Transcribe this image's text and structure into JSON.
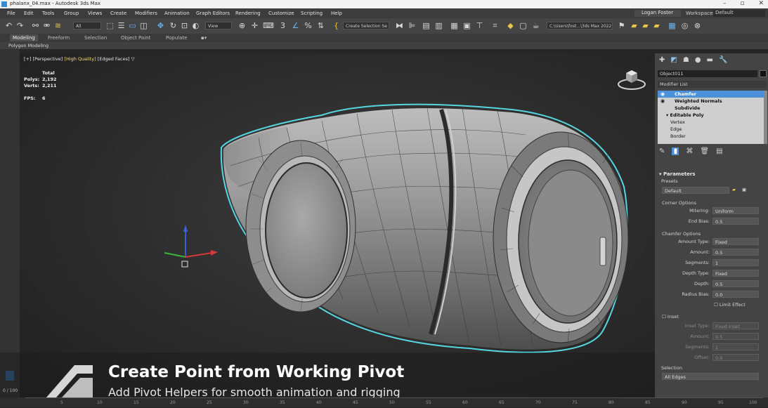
{
  "window": {
    "title": "phalanx_04.max - Autodesk 3ds Max",
    "controls": [
      "–",
      "▫",
      "✕"
    ]
  },
  "menu": [
    "File",
    "Edit",
    "Tools",
    "Group",
    "Views",
    "Create",
    "Modifiers",
    "Animation",
    "Graph Editors",
    "Rendering",
    "Customize",
    "Scripting",
    "Help"
  ],
  "user": {
    "name": "Logan Foster",
    "workspaces_label": "Workspaces:",
    "workspace": "Default"
  },
  "toolbar": {
    "filter": "All",
    "ref_coord": "View",
    "selection_set": "Create Selection Se",
    "project_path": "C:\\Users\\fost...\\3ds Max 2022"
  },
  "ribbon": {
    "tabs": [
      "Modeling",
      "Freeform",
      "Selection",
      "Object Paint",
      "Populate"
    ],
    "active": "Modeling",
    "panel_label": "Polygon Modeling"
  },
  "viewport": {
    "label_parts": [
      "[+]",
      "[Perspective]",
      "[High Quality]",
      "[Edged Faces]"
    ],
    "stats": {
      "header": "Total",
      "polys_label": "Polys:",
      "polys": "2,192",
      "verts_label": "Verts:",
      "verts": "2,211",
      "fps_label": "FPS:",
      "fps": "6"
    }
  },
  "command_panel": {
    "object_name": "Object011",
    "modifier_list": "Modifier List",
    "stack": [
      {
        "label": "Chamfer",
        "selected": true,
        "eye": true
      },
      {
        "label": "Weighted Normals",
        "selected": false,
        "eye": true
      },
      {
        "label": "Subdivide",
        "selected": false,
        "eye": false
      },
      {
        "label": "Editable Poly",
        "selected": false,
        "eye": false
      },
      {
        "label": "Vertex",
        "selected": false,
        "eye": false,
        "sub": true
      },
      {
        "label": "Edge",
        "selected": false,
        "eye": false,
        "sub": true
      },
      {
        "label": "Border",
        "selected": false,
        "eye": false,
        "sub": true
      }
    ],
    "parameters": {
      "header": "Parameters",
      "presets_label": "Presets",
      "presets_value": "Default",
      "corner_options": "Corner Options",
      "mitering_label": "Mitering:",
      "mitering": "Uniform",
      "end_bias_label": "End Bias:",
      "end_bias": "0.5",
      "chamfer_options": "Chamfer Options",
      "amount_type_label": "Amount Type:",
      "amount_type": "Fixed",
      "amount_label": "Amount:",
      "amount": "0.5",
      "segments_label": "Segments:",
      "segments": "1",
      "depth_type_label": "Depth Type:",
      "depth_type": "Fixed",
      "depth_label": "Depth:",
      "depth": "0.5",
      "radius_bias_label": "Radius Bias:",
      "radius_bias": "0.0",
      "limit_effect": "Limit Effect",
      "inset_label": "Inset",
      "inset_type_label": "Inset Type:",
      "inset_type": "Fixed Inset",
      "inset_amount_label": "Amount:",
      "inset_amount": "0.5",
      "inset_segments_label": "Segments:",
      "inset_segments": "1",
      "offset_label": "Offset:",
      "offset": "0.0",
      "selection_label": "Selection",
      "selection_value": "All Edges"
    }
  },
  "caption": {
    "title": "Create Point from Working Pivot",
    "subtitle": "Add Pivot Helpers for smooth animation and rigging"
  },
  "timeline": {
    "counter": "0 / 100",
    "frames": [
      "5",
      "10",
      "15",
      "20",
      "25",
      "30",
      "35",
      "40",
      "45",
      "50",
      "55",
      "60",
      "65",
      "70",
      "75",
      "80",
      "85",
      "90",
      "95",
      "100"
    ]
  },
  "colors": {
    "accent": "#4b90d8",
    "selection_outline": "#56d6e0",
    "hq_label": "#f2e068"
  }
}
